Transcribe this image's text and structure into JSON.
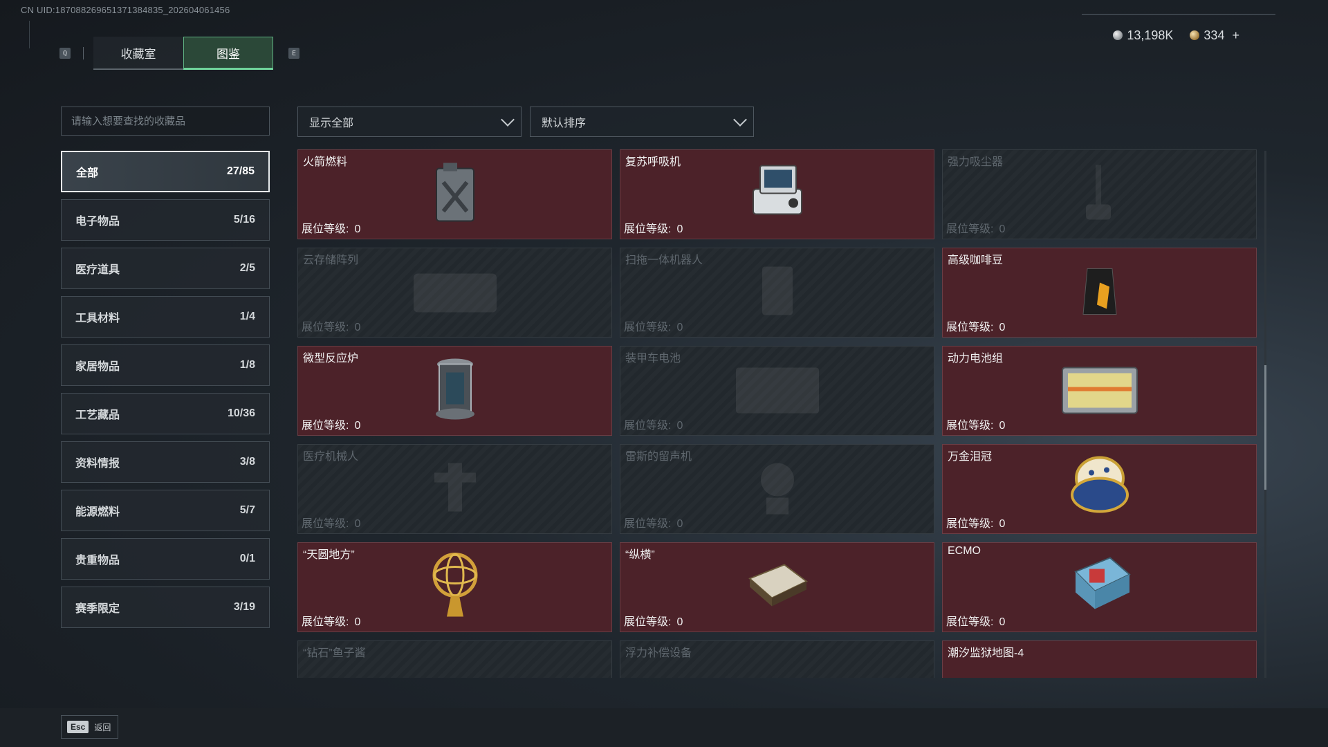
{
  "uid": "CN UID:187088269651371384835_202604061456",
  "tabs": {
    "left_key": "Q",
    "right_key": "E",
    "items": [
      {
        "label": "收藏室",
        "active": false
      },
      {
        "label": "图鉴",
        "active": true
      }
    ]
  },
  "currency": {
    "silver": "13,198K",
    "gold": "334",
    "add": "+"
  },
  "search": {
    "placeholder": "请输入想要查找的收藏品"
  },
  "filters": {
    "display": "显示全部",
    "sort": "默认排序"
  },
  "categories": [
    {
      "label": "全部",
      "count": "27/85",
      "active": true
    },
    {
      "label": "电子物品",
      "count": "5/16"
    },
    {
      "label": "医疗道具",
      "count": "2/5"
    },
    {
      "label": "工具材料",
      "count": "1/4"
    },
    {
      "label": "家居物品",
      "count": "1/8"
    },
    {
      "label": "工艺藏品",
      "count": "10/36"
    },
    {
      "label": "资料情报",
      "count": "3/8"
    },
    {
      "label": "能源燃料",
      "count": "5/7"
    },
    {
      "label": "贵重物品",
      "count": "0/1"
    },
    {
      "label": "赛季限定",
      "count": "3/19"
    }
  ],
  "level_label": "展位等级:",
  "items": [
    {
      "name": "火箭燃料",
      "level": "0",
      "owned": true,
      "icon": "fuel-canister-icon"
    },
    {
      "name": "复苏呼吸机",
      "level": "0",
      "owned": true,
      "icon": "ventilator-icon"
    },
    {
      "name": "强力吸尘器",
      "level": "0",
      "owned": false,
      "icon": "vacuum-icon"
    },
    {
      "name": "云存储阵列",
      "level": "0",
      "owned": false,
      "icon": "storage-array-icon"
    },
    {
      "name": "扫拖一体机器人",
      "level": "0",
      "owned": false,
      "icon": "robot-vacuum-icon"
    },
    {
      "name": "高级咖啡豆",
      "level": "0",
      "owned": true,
      "icon": "coffee-bag-icon"
    },
    {
      "name": "微型反应炉",
      "level": "0",
      "owned": true,
      "icon": "reactor-icon"
    },
    {
      "name": "装甲车电池",
      "level": "0",
      "owned": false,
      "icon": "battery-icon"
    },
    {
      "name": "动力电池组",
      "level": "0",
      "owned": true,
      "icon": "battery-pack-icon"
    },
    {
      "name": "医疗机械人",
      "level": "0",
      "owned": false,
      "icon": "medical-robot-icon"
    },
    {
      "name": "雷斯的留声机",
      "level": "0",
      "owned": false,
      "icon": "gramophone-icon"
    },
    {
      "name": "万金泪冠",
      "level": "0",
      "owned": true,
      "icon": "jeweled-egg-icon"
    },
    {
      "name": "“天圆地方”",
      "level": "0",
      "owned": true,
      "icon": "armillary-sphere-icon"
    },
    {
      "name": "“纵横”",
      "level": "0",
      "owned": true,
      "icon": "chessboard-icon"
    },
    {
      "name": "ECMO",
      "level": "0",
      "owned": true,
      "icon": "ecmo-machine-icon"
    },
    {
      "name": "“钻石”鱼子酱",
      "level": "",
      "owned": false,
      "icon": "caviar-icon"
    },
    {
      "name": "浮力补偿设备",
      "level": "",
      "owned": false,
      "icon": "bcd-icon"
    },
    {
      "name": "潮汐监狱地图-4",
      "level": "",
      "owned": true,
      "icon": "map-icon"
    }
  ],
  "footer": {
    "esc_key": "Esc",
    "back": "返回"
  }
}
